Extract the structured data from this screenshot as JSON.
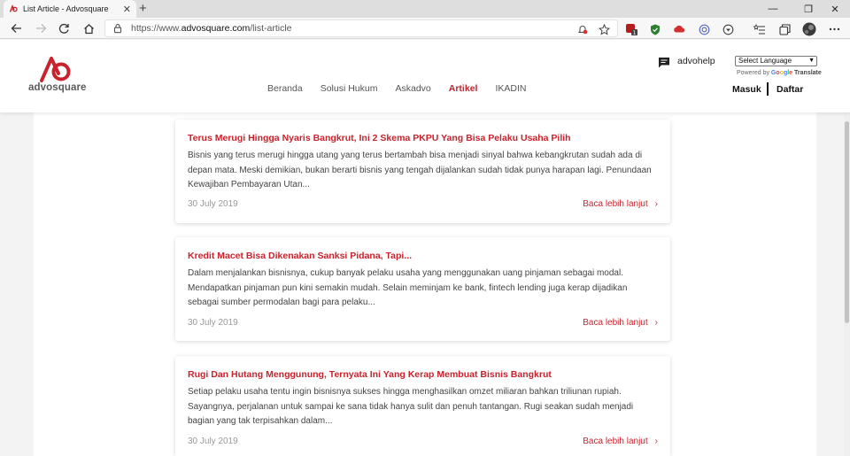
{
  "browser": {
    "tab_title": "List Article - Advosquare",
    "url_prefix": "https://www.",
    "url_host": "advosquare.com",
    "url_path": "/list-article",
    "new_tab": "+",
    "close_tab": "✕",
    "window": {
      "minimize": "—",
      "maximize": "❐",
      "close": "✕"
    },
    "ext_badge": "1"
  },
  "site": {
    "logo_text": "advosquare",
    "nav": [
      "Beranda",
      "Solusi Hukum",
      "Askadvo",
      "Artikel",
      "IKADIN"
    ],
    "nav_active": "Artikel",
    "help_label": "advohelp",
    "language_select": "Select Language",
    "powered_by": "Powered by",
    "google": "Google",
    "translate": "Translate",
    "login": "Masuk",
    "register": "Daftar"
  },
  "articles": [
    {
      "title": "Terus Merugi Hingga Nyaris Bangkrut, Ini 2 Skema PKPU Yang Bisa Pelaku Usaha Pilih",
      "excerpt": "Bisnis yang terus merugi hingga utang yang terus bertambah bisa menjadi sinyal bahwa kebangkrutan sudah ada di depan mata. Meski demikian, bukan berarti bisnis yang tengah dijalankan sudah tidak punya harapan lagi. Penundaan Kewajiban Pembayaran Utan...",
      "date": "30 July 2019",
      "more": "Baca lebih lanjut"
    },
    {
      "title": "Kredit Macet Bisa Dikenakan Sanksi Pidana, Tapi...",
      "excerpt": "Dalam menjalankan bisnisnya, cukup banyak pelaku usaha yang menggunakan uang pinjaman sebagai modal. Mendapatkan pinjaman pun kini semakin mudah. Selain meminjam ke bank, fintech lending juga kerap dijadikan sebagai sumber permodalan bagi para pelaku...",
      "date": "30 July 2019",
      "more": "Baca lebih lanjut"
    },
    {
      "title": "Rugi Dan Hutang Menggunung, Ternyata Ini Yang Kerap Membuat Bisnis Bangkrut",
      "excerpt": "Setiap pelaku usaha tentu ingin bisnisnya sukses hingga menghasilkan omzet miliaran bahkan triliunan rupiah. Sayangnya, perjalanan untuk sampai ke sana tidak hanya sulit dan penuh tantangan. Rugi seakan sudah menjadi bagian yang tak terpisahkan dalam...",
      "date": "30 July 2019",
      "more": "Baca lebih lanjut"
    }
  ],
  "colors": {
    "brand": "#c8232c",
    "page_bg": "#f3f3f3",
    "card_bg": "#ffffff"
  }
}
